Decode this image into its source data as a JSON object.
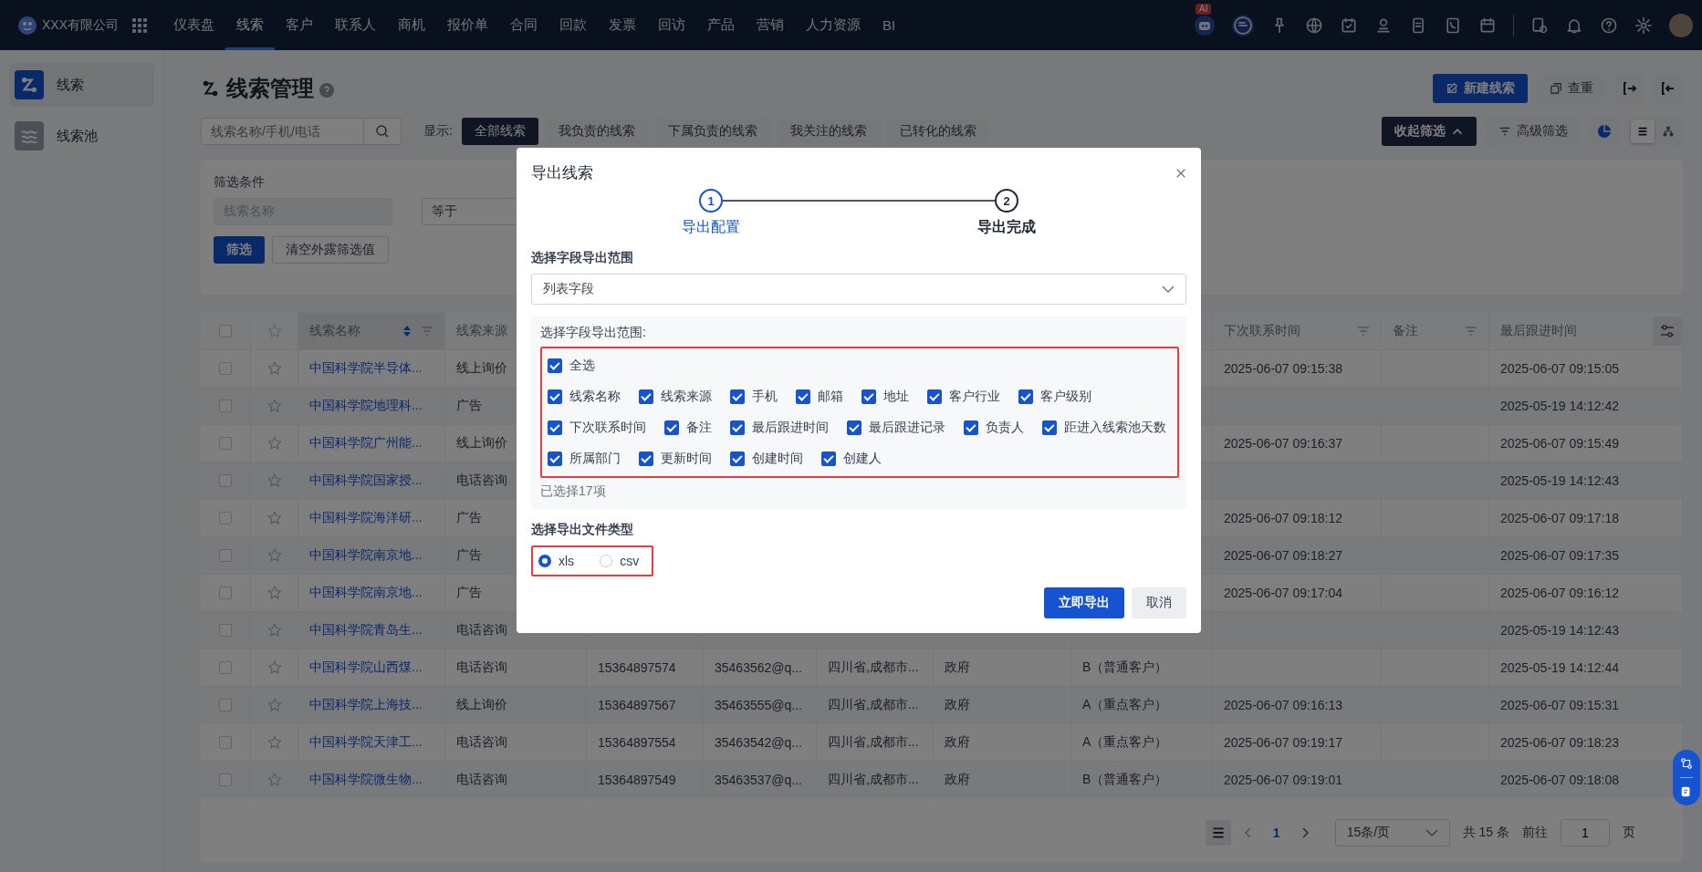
{
  "topbar": {
    "company": "XXX有限公司",
    "ai_badge": "AI",
    "nav": [
      {
        "label": "仪表盘",
        "selected": false
      },
      {
        "label": "线索",
        "selected": true
      },
      {
        "label": "客户",
        "selected": false
      },
      {
        "label": "联系人",
        "selected": false
      },
      {
        "label": "商机",
        "selected": false
      },
      {
        "label": "报价单",
        "selected": false
      },
      {
        "label": "合同",
        "selected": false
      },
      {
        "label": "回款",
        "selected": false
      },
      {
        "label": "发票",
        "selected": false
      },
      {
        "label": "回访",
        "selected": false
      },
      {
        "label": "产品",
        "selected": false
      },
      {
        "label": "营销",
        "selected": false
      },
      {
        "label": "人力资源",
        "selected": false
      },
      {
        "label": "BI",
        "selected": false
      }
    ]
  },
  "sidebar": {
    "items": [
      {
        "label": "线索",
        "selected": true
      },
      {
        "label": "线索池",
        "selected": false
      }
    ]
  },
  "page": {
    "title": "线索管理",
    "new_button": "新建线索",
    "dedupe_button": "查重"
  },
  "toolbar": {
    "search_placeholder": "线索名称/手机/电话",
    "show_label": "显示:",
    "views": [
      {
        "label": "全部线索",
        "selected": true
      },
      {
        "label": "我负责的线索",
        "selected": false
      },
      {
        "label": "下属负责的线索",
        "selected": false
      },
      {
        "label": "我关注的线索",
        "selected": false
      },
      {
        "label": "已转化的线索",
        "selected": false
      }
    ],
    "collapse_button": "收起筛选",
    "advanced_button": "高级筛选",
    "layouts": [
      {
        "kind": "list",
        "selected": true
      },
      {
        "kind": "tree",
        "selected": false
      }
    ]
  },
  "filter": {
    "title": "筛选条件",
    "field": "线索名称",
    "operator": "等于",
    "apply_button": "筛选",
    "clear_button": "清空外露筛选值"
  },
  "table": {
    "all_checked": false,
    "header": {
      "name": "线索名称",
      "source": "线索来源",
      "next_contact": "下次联系时间",
      "note": "备注",
      "last_follow": "最后跟进时间"
    },
    "rows": [
      {
        "checked": false,
        "name": "中国科学院半导体...",
        "source": "线上询价",
        "next_contact": "2025-06-07 09:15:38",
        "last_follow": "2025-06-07 09:15:05"
      },
      {
        "checked": false,
        "name": "中国科学院地理科...",
        "source": "广告",
        "last_follow": "2025-05-19 14:12:42"
      },
      {
        "checked": false,
        "name": "中国科学院广州能...",
        "source": "线上询价",
        "next_contact": "2025-06-07 09:16:37",
        "last_follow": "2025-06-07 09:15:49"
      },
      {
        "checked": false,
        "name": "中国科学院国家授...",
        "source": "电话咨询",
        "last_follow": "2025-05-19 14:12:43"
      },
      {
        "checked": false,
        "name": "中国科学院海洋研...",
        "source": "广告",
        "next_contact": "2025-06-07 09:18:12",
        "last_follow": "2025-06-07 09:17:18"
      },
      {
        "checked": false,
        "name": "中国科学院南京地...",
        "source": "广告",
        "next_contact": "2025-06-07 09:18:27",
        "last_follow": "2025-06-07 09:17:35"
      },
      {
        "checked": false,
        "name": "中国科学院南京地...",
        "source": "广告",
        "next_contact": "2025-06-07 09:17:04",
        "last_follow": "2025-06-07 09:16:12"
      },
      {
        "checked": false,
        "name": "中国科学院青岛生...",
        "source": "电话咨询",
        "last_follow": "2025-05-19 14:12:43"
      },
      {
        "checked": false,
        "name": "中国科学院山西煤...",
        "source": "电话咨询",
        "phone": "15364897574",
        "email": "35463562@q...",
        "address": "四川省,成都市...",
        "industry": "政府",
        "level": "B（普通客户）",
        "last_follow": "2025-05-19 14:12:44"
      },
      {
        "checked": false,
        "name": "中国科学院上海技...",
        "source": "线上询价",
        "phone": "15364897567",
        "email": "35463555@q...",
        "address": "四川省,成都市...",
        "industry": "政府",
        "level": "A（重点客户）",
        "next_contact": "2025-06-07 09:16:13",
        "last_follow": "2025-06-07 09:15:31"
      },
      {
        "checked": false,
        "name": "中国科学院天津工...",
        "source": "电话咨询",
        "phone": "15364897554",
        "email": "35463542@q...",
        "address": "四川省,成都市...",
        "industry": "政府",
        "level": "A（重点客户）",
        "next_contact": "2025-06-07 09:19:17",
        "last_follow": "2025-06-07 09:18:23"
      },
      {
        "checked": false,
        "name": "中国科学院微生物...",
        "source": "电话咨询",
        "phone": "15364897549",
        "email": "35463537@q...",
        "address": "四川省,成都市...",
        "industry": "政府",
        "level": "B（普通客户）",
        "next_contact": "2025-06-07 09:19:01",
        "last_follow": "2025-06-07 09:18:08"
      }
    ]
  },
  "pagination": {
    "current_page": "1",
    "page_size": "15条/页",
    "total": "共 15 条",
    "goto_label": "前往",
    "goto_value": "1",
    "page_suffix": "页"
  },
  "export_dialog": {
    "title": "导出线索",
    "steps": [
      {
        "number": "1",
        "label": "导出配置",
        "selected": true
      },
      {
        "number": "2",
        "label": "导出完成",
        "selected": false
      }
    ],
    "scope_label": "选择字段导出范围",
    "scope_value": "列表字段",
    "fields_label": "选择字段导出范围:",
    "fields": {
      "highlighted": true,
      "select_all": {
        "label": "全选",
        "checked": true
      },
      "rows": [
        [
          {
            "label": "线索名称",
            "checked": true
          },
          {
            "label": "线索来源",
            "checked": true
          },
          {
            "label": "手机",
            "checked": true
          },
          {
            "label": "邮箱",
            "checked": true
          },
          {
            "label": "地址",
            "checked": true
          },
          {
            "label": "客户行业",
            "checked": true
          },
          {
            "label": "客户级别",
            "checked": true
          }
        ],
        [
          {
            "label": "下次联系时间",
            "checked": true
          },
          {
            "label": "备注",
            "checked": true
          },
          {
            "label": "最后跟进时间",
            "checked": true
          },
          {
            "label": "最后跟进记录",
            "checked": true
          },
          {
            "label": "负责人",
            "checked": true
          },
          {
            "label": "距进入线索池天数",
            "checked": true
          }
        ],
        [
          {
            "label": "所属部门",
            "checked": true
          },
          {
            "label": "更新时间",
            "checked": true
          },
          {
            "label": "创建时间",
            "checked": true
          },
          {
            "label": "创建人",
            "checked": true
          }
        ]
      ]
    },
    "selected_count": "已选择17项",
    "file_type_label": "选择导出文件类型",
    "file_types": {
      "highlighted": true,
      "options": [
        {
          "label": "xls",
          "selected": true
        },
        {
          "label": "csv",
          "selected": false
        }
      ]
    },
    "confirm_button": "立即导出",
    "cancel_button": "取消"
  }
}
